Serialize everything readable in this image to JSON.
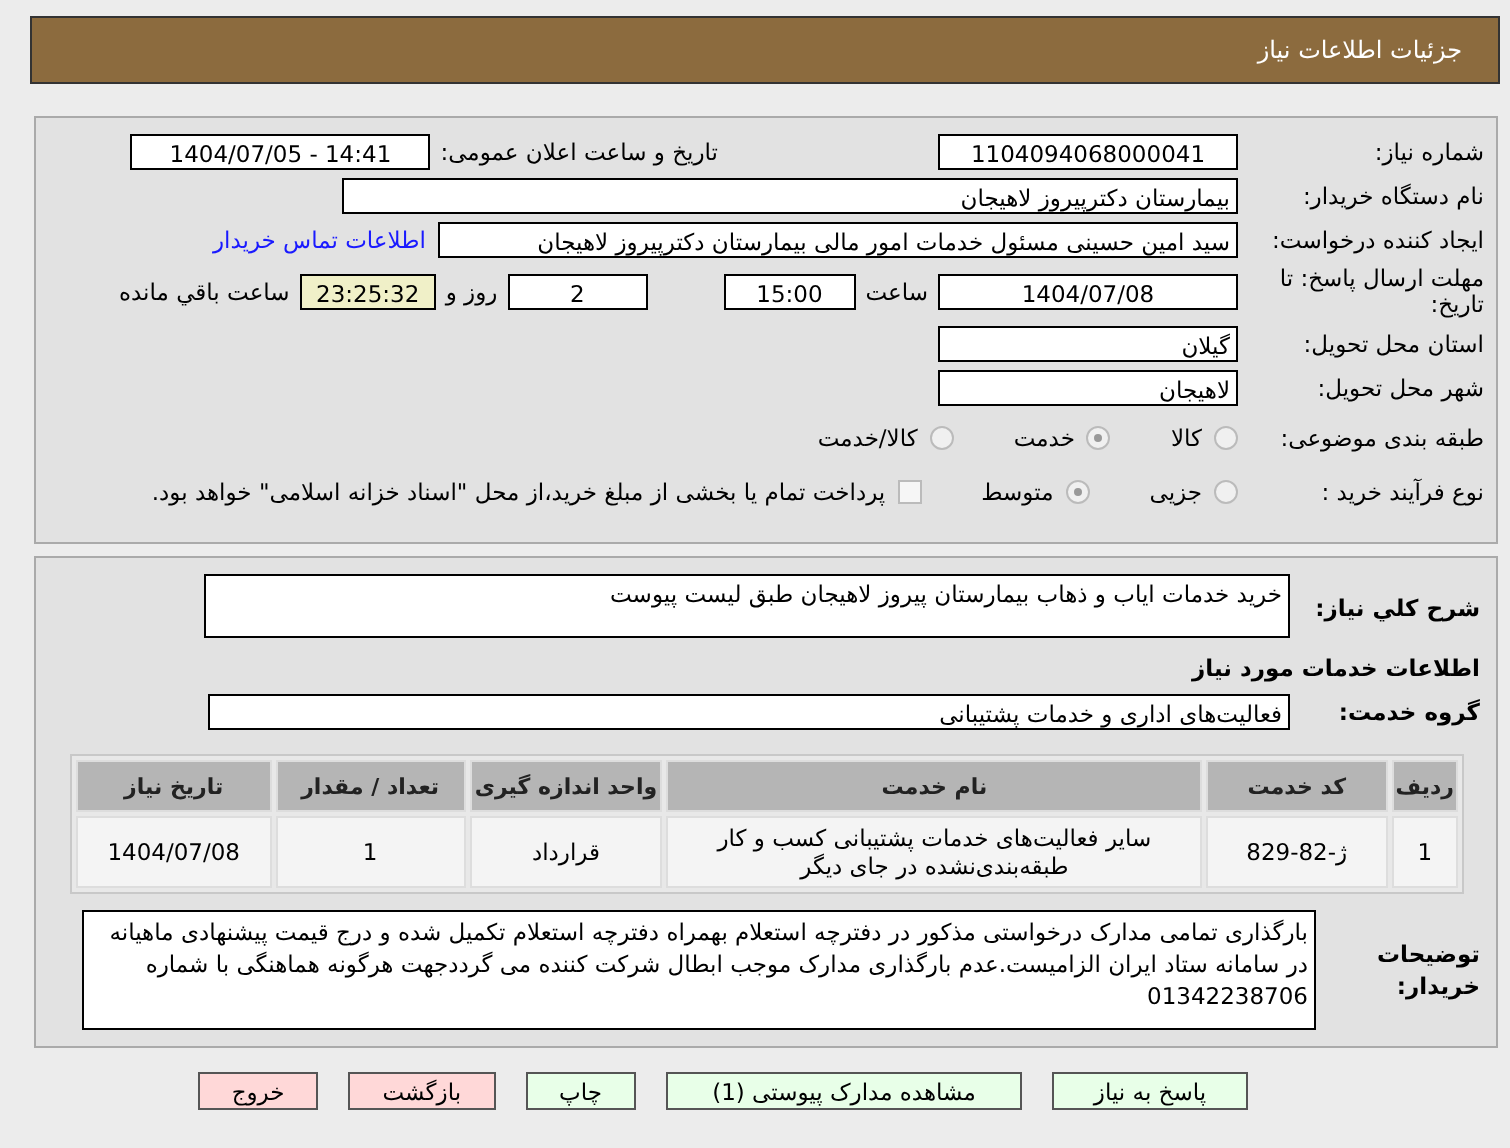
{
  "header": {
    "title": "جزئیات اطلاعات نیاز"
  },
  "details": {
    "need_number": {
      "label": "شماره نیاز:",
      "value": "1104094068000041"
    },
    "announce": {
      "label": "تاریخ و ساعت اعلان عمومی:",
      "value": "1404/07/05 - 14:41"
    },
    "buyer": {
      "label": "نام دستگاه خریدار:",
      "value": "بیمارستان دکترپیروز لاهیجان"
    },
    "creator": {
      "label": "ایجاد کننده درخواست:",
      "value": "سید امین حسینی مسئول خدمات امور مالی بیمارستان دکترپیروز لاهیجان",
      "link": "اطلاعات تماس خریدار"
    },
    "deadline": {
      "label": "مهلت ارسال پاسخ: تا تاریخ:",
      "date": "1404/07/08",
      "time_label": "ساعت",
      "time": "15:00",
      "days": "2",
      "days_label": "روز و",
      "remaining": "23:25:32",
      "remaining_label": "ساعت باقي مانده"
    },
    "province": {
      "label": "استان محل تحویل:",
      "value": "گیلان"
    },
    "city": {
      "label": "شهر محل تحویل:",
      "value": "لاهیجان"
    },
    "category": {
      "label": "طبقه بندی موضوعی:",
      "options": [
        {
          "label": "کالا",
          "selected": false
        },
        {
          "label": "خدمت",
          "selected": true
        },
        {
          "label": "کالا/خدمت",
          "selected": false
        }
      ]
    },
    "process": {
      "label": "نوع فرآیند خرید :",
      "options": [
        {
          "label": "جزیی",
          "selected": false
        },
        {
          "label": "متوسط",
          "selected": true
        }
      ],
      "payment": {
        "checked": false,
        "text": "پرداخت تمام یا بخشی از مبلغ خرید،از محل \"اسناد خزانه اسلامی\" خواهد بود."
      }
    }
  },
  "need": {
    "description_label": "شرح کلي نياز:",
    "description": "خرید خدمات ایاب و ذهاب بیمارستان پیروز لاهیجان طبق لیست پیوست",
    "services_heading": "اطلاعات خدمات مورد نیاز",
    "group_label": "گروه خدمت:",
    "group": "فعالیت‌های اداری و خدمات پشتیبانی",
    "table": {
      "columns": [
        "ردیف",
        "کد خدمت",
        "نام خدمت",
        "واحد اندازه گیری",
        "تعداد / مقدار",
        "تاریخ نیاز"
      ],
      "rows": [
        [
          "1",
          "ژ-82-829",
          "سایر فعالیت‌های خدمات پشتیبانی کسب و کار طبقه‌بندی‌نشده در جای دیگر",
          "قرارداد",
          "1",
          "1404/07/08"
        ]
      ]
    },
    "notes_label": "توضیحات خریدار:",
    "notes": "بارگذاری تمامی مدارک درخواستی مذکور در دفترچه استعلام بهمراه دفترچه استعلام تکمیل شده و درج قیمت پیشنهادی ماهیانه در سامانه ستاد ایران الزامیست.عدم بارگذاری مدارک موجب ابطال شرکت کننده می گرددجهت هرگونه هماهنگی با شماره 01342238706"
  },
  "buttons": [
    {
      "label": "پاسخ به نیاز",
      "kind": "normal"
    },
    {
      "label": "مشاهده مدارک پیوستی (1)",
      "kind": "normal"
    },
    {
      "label": "چاپ",
      "kind": "normal"
    },
    {
      "label": "بازگشت",
      "kind": "danger"
    },
    {
      "label": "خروج",
      "kind": "danger"
    }
  ]
}
